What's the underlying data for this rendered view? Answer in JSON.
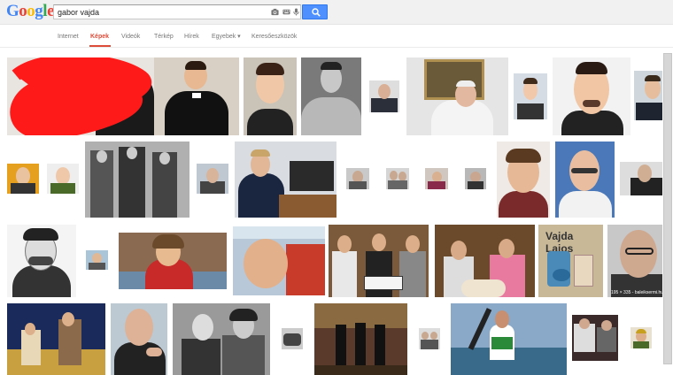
{
  "logo": [
    "G",
    "o",
    "o",
    "g",
    "l",
    "e"
  ],
  "search": {
    "query": "gabor vajda"
  },
  "nav": {
    "internet": "Internet",
    "kepek": "Képek",
    "videok": "Videók",
    "terkep": "Térkép",
    "hirek": "Hírek",
    "egyebek": "Egyebek ▾",
    "keresoeszkozok": "Keresőeszközök"
  },
  "thumbs": {
    "vajda_lajos_text": "Vajda Lajos",
    "photo_caption": "195 × 335 - baleiksermi.hu"
  },
  "colors": {
    "accent_red": "#dd4b39",
    "search_blue": "#4d90fe",
    "redaction": "#ff1a1a"
  }
}
